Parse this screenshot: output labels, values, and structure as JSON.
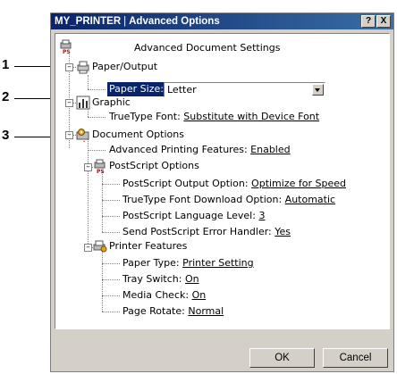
{
  "window": {
    "title_printer": "MY_PRINTER",
    "title_separator": "|",
    "title_section": "Advanced Options",
    "help_button": "?",
    "close_button": "X"
  },
  "callouts": [
    "1",
    "2",
    "3"
  ],
  "tree": {
    "root_label": "Advanced Document Settings",
    "paper_output": {
      "label": "Paper/Output",
      "paper_size_label": "Paper Size:",
      "paper_size_value": "Letter"
    },
    "graphic": {
      "label": "Graphic",
      "truetype_label": "TrueType Font:",
      "truetype_value": "Substitute with Device Font"
    },
    "document_options": {
      "label": "Document Options",
      "advanced_printing_label": "Advanced Printing Features:",
      "advanced_printing_value": "Enabled",
      "postscript": {
        "label": "PostScript Options",
        "output_option_label": "PostScript Output Option:",
        "output_option_value": "Optimize for Speed",
        "download_option_label": "TrueType Font Download Option:",
        "download_option_value": "Automatic",
        "language_level_label": "PostScript Language Level:",
        "language_level_value": "3",
        "error_handler_label": "Send PostScript Error Handler:",
        "error_handler_value": "Yes"
      },
      "printer_features": {
        "label": "Printer Features",
        "paper_type_label": "Paper Type:",
        "paper_type_value": "Printer Setting",
        "tray_switch_label": "Tray Switch:",
        "tray_switch_value": "On",
        "media_check_label": "Media Check:",
        "media_check_value": "On",
        "page_rotate_label": "Page Rotate:",
        "page_rotate_value": "Normal"
      }
    }
  },
  "buttons": {
    "ok": "OK",
    "cancel": "Cancel"
  },
  "icons": {
    "root": "ps-printer-icon",
    "paper_output": "paper-output-icon",
    "graphic": "graphic-chart-icon",
    "document_options": "document-options-icon",
    "postscript": "ps-printer-icon",
    "printer_features": "printer-features-icon"
  }
}
